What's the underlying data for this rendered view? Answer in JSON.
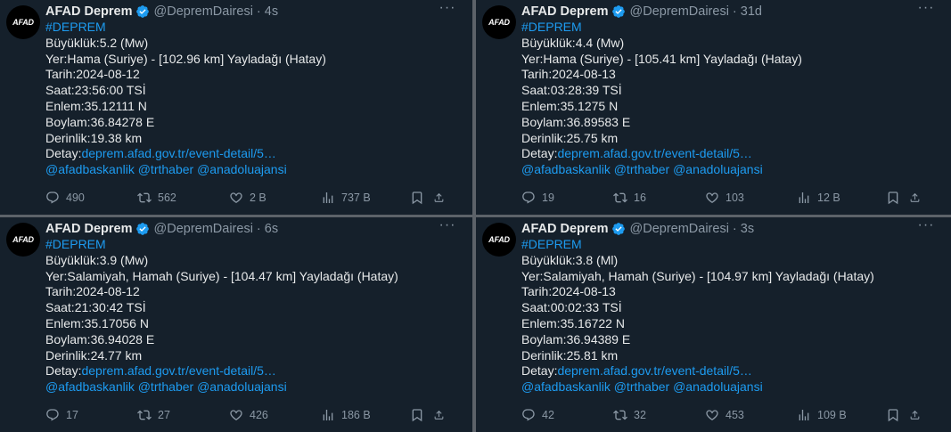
{
  "accent": "#1d9bf0",
  "tweets": [
    {
      "avatar_text": "AFAD",
      "name": "AFAD Deprem",
      "handle": "@DeprемDairesi",
      "time": "4s",
      "hashtag": "#DEPREM",
      "lines": [
        "Büyüklük:5.2 (Mw)",
        "Yer:Hama (Suriye) - [102.96 km] Yayladağı (Hatay)",
        "Tarih:2024-08-12",
        "Saat:23:56:00 TSİ",
        "Enlem:35.12111 N",
        "Boylam:36.84278 E",
        "Derinlik:19.38 km"
      ],
      "detail_label": "Detay:",
      "detail_link": "deprem.afad.gov.tr/event-detail/5…",
      "mentions": "@afadbaskanlik @trthaber @anadoluajansi",
      "replies": "490",
      "retweets": "562",
      "likes": "2 B",
      "views": "737 B"
    },
    {
      "avatar_text": "AFAD",
      "name": "AFAD Deprem",
      "handle": "@DepremDairesi",
      "time": "31d",
      "hashtag": "#DEPREM",
      "lines": [
        "Büyüklük:4.4 (Mw)",
        "Yer:Hama (Suriye) - [105.41 km] Yayladağı (Hatay)",
        "Tarih:2024-08-13",
        "Saat:03:28:39 TSİ",
        "Enlem:35.1275 N",
        "Boylam:36.89583 E",
        "Derinlik:25.75 km"
      ],
      "detail_label": "Detay:",
      "detail_link": "deprem.afad.gov.tr/event-detail/5…",
      "mentions": "@afadbaskanlik @trthaber @anadoluajansi",
      "replies": "19",
      "retweets": "16",
      "likes": "103",
      "views": "12 B"
    },
    {
      "avatar_text": "AFAD",
      "name": "AFAD Deprem",
      "handle": "@DepremDairesi",
      "time": "6s",
      "hashtag": "#DEPREM",
      "lines": [
        "Büyüklük:3.9 (Mw)",
        "Yer:Salamiyah, Hamah (Suriye) - [104.47 km] Yayladağı (Hatay)",
        "Tarih:2024-08-12",
        "Saat:21:30:42 TSİ",
        "Enlem:35.17056 N",
        "Boylam:36.94028 E",
        "Derinlik:24.77 km"
      ],
      "detail_label": "Detay:",
      "detail_link": "deprem.afad.gov.tr/event-detail/5…",
      "mentions": "@afadbaskanlik @trthaber @anadoluajansi",
      "replies": "17",
      "retweets": "27",
      "likes": "426",
      "views": "186 B"
    },
    {
      "avatar_text": "AFAD",
      "name": "AFAD Deprem",
      "handle": "@DepremDairesi",
      "time": "3s",
      "hashtag": "#DEPREM",
      "lines": [
        "Büyüklük:3.8 (Ml)",
        "Yer:Salamiyah, Hamah (Suriye) - [104.97 km] Yayladağı (Hatay)",
        "Tarih:2024-08-13",
        "Saat:00:02:33 TSİ",
        "Enlem:35.16722 N",
        "Boylam:36.94389 E",
        "Derinlik:25.81 km"
      ],
      "detail_label": "Detay:",
      "detail_link": "deprem.afad.gov.tr/event-detail/5…",
      "mentions": "@afadbaskanlik @trthaber @anadoluajansi",
      "replies": "42",
      "retweets": "32",
      "likes": "453",
      "views": "109 B"
    }
  ]
}
